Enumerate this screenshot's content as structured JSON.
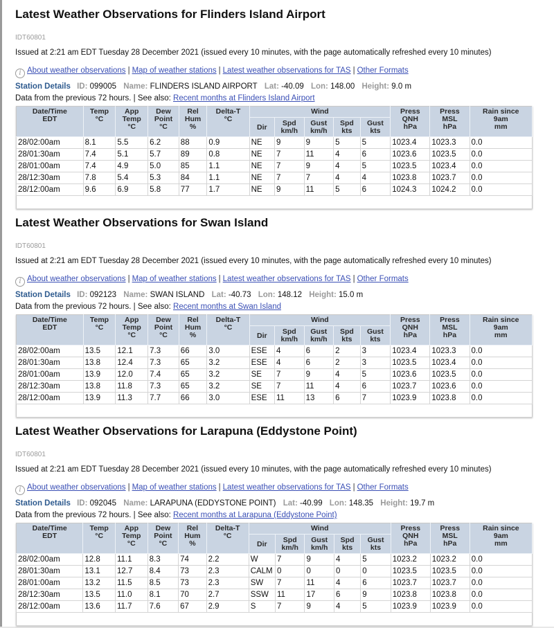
{
  "columns": {
    "date": [
      "Date/Time",
      "EDT"
    ],
    "temp": [
      "Temp",
      "°C"
    ],
    "app_temp": [
      "App",
      "Temp",
      "°C"
    ],
    "dew": [
      "Dew",
      "Point",
      "°C"
    ],
    "hum": [
      "Rel",
      "Hum",
      "%"
    ],
    "delta_t": [
      "Delta-T",
      "°C"
    ],
    "wind": "Wind",
    "dir": "Dir",
    "spd_kmh": [
      "Spd",
      "km/h"
    ],
    "gust_kmh": [
      "Gust",
      "km/h"
    ],
    "spd_kts": [
      "Spd",
      "kts"
    ],
    "gust_kts": [
      "Gust",
      "kts"
    ],
    "press_qnh": [
      "Press",
      "QNH",
      "hPa"
    ],
    "press_msl": [
      "Press",
      "MSL",
      "hPa"
    ],
    "rain": [
      "Rain since",
      "9am",
      "mm"
    ]
  },
  "labels": {
    "station_details": "Station Details",
    "id": "ID:",
    "name": "Name:",
    "lat": "Lat:",
    "lon": "Lon:",
    "height": "Height:",
    "data_from": "Data from the previous 72 hours. | See also:",
    "separator": "|"
  },
  "links": {
    "about": "About weather observations",
    "map": "Map of weather stations",
    "latest_tas": "Latest weather observations for TAS",
    "other_formats": "Other Formats"
  },
  "sections": [
    {
      "title": "Latest Weather Observations for Flinders Island Airport",
      "product_id": "IDT60801",
      "issued": "Issued at 2:21 am EDT Tuesday 28 December 2021 (issued every 10 minutes, with the page automatically refreshed every 10 minutes)",
      "station": {
        "id": "099005",
        "name": "FLINDERS ISLAND AIRPORT",
        "lat": "-40.09",
        "lon": "148.00",
        "height": "9.0 m"
      },
      "recent_link": "Recent months at Flinders Island Airport",
      "rows": [
        [
          "28/02:00am",
          "8.1",
          "5.5",
          "6.2",
          "88",
          "0.9",
          "NE",
          "9",
          "9",
          "5",
          "5",
          "1023.4",
          "1023.3",
          "0.0"
        ],
        [
          "28/01:30am",
          "7.4",
          "5.1",
          "5.7",
          "89",
          "0.8",
          "NE",
          "7",
          "11",
          "4",
          "6",
          "1023.6",
          "1023.5",
          "0.0"
        ],
        [
          "28/01:00am",
          "7.4",
          "4.9",
          "5.0",
          "85",
          "1.1",
          "NE",
          "7",
          "9",
          "4",
          "5",
          "1023.5",
          "1023.4",
          "0.0"
        ],
        [
          "28/12:30am",
          "7.8",
          "5.4",
          "5.3",
          "84",
          "1.1",
          "NE",
          "7",
          "7",
          "4",
          "4",
          "1023.8",
          "1023.7",
          "0.0"
        ],
        [
          "28/12:00am",
          "9.6",
          "6.9",
          "5.8",
          "77",
          "1.7",
          "NE",
          "9",
          "11",
          "5",
          "6",
          "1024.3",
          "1024.2",
          "0.0"
        ]
      ]
    },
    {
      "title": "Latest Weather Observations for Swan Island",
      "product_id": "IDT60801",
      "issued": "Issued at 2:21 am EDT Tuesday 28 December 2021 (issued every 10 minutes, with the page automatically refreshed every 10 minutes)",
      "station": {
        "id": "092123",
        "name": "SWAN ISLAND",
        "lat": "-40.73",
        "lon": "148.12",
        "height": "15.0 m"
      },
      "recent_link": "Recent months at Swan Island",
      "rows": [
        [
          "28/02:00am",
          "13.5",
          "12.1",
          "7.3",
          "66",
          "3.0",
          "ESE",
          "4",
          "6",
          "2",
          "3",
          "1023.4",
          "1023.3",
          "0.0"
        ],
        [
          "28/01:30am",
          "13.8",
          "12.4",
          "7.3",
          "65",
          "3.2",
          "ESE",
          "4",
          "6",
          "2",
          "3",
          "1023.5",
          "1023.4",
          "0.0"
        ],
        [
          "28/01:00am",
          "13.9",
          "12.0",
          "7.4",
          "65",
          "3.2",
          "SE",
          "7",
          "9",
          "4",
          "5",
          "1023.6",
          "1023.5",
          "0.0"
        ],
        [
          "28/12:30am",
          "13.8",
          "11.8",
          "7.3",
          "65",
          "3.2",
          "SE",
          "7",
          "11",
          "4",
          "6",
          "1023.7",
          "1023.6",
          "0.0"
        ],
        [
          "28/12:00am",
          "13.9",
          "11.3",
          "7.7",
          "66",
          "3.0",
          "ESE",
          "11",
          "13",
          "6",
          "7",
          "1023.9",
          "1023.8",
          "0.0"
        ]
      ]
    },
    {
      "title": "Latest Weather Observations for Larapuna (Eddystone Point)",
      "product_id": "IDT60801",
      "issued": "Issued at 2:21 am EDT Tuesday 28 December 2021 (issued every 10 minutes, with the page automatically refreshed every 10 minutes)",
      "station": {
        "id": "092045",
        "name": "LARAPUNA (EDDYSTONE POINT)",
        "lat": "-40.99",
        "lon": "148.35",
        "height": "19.7 m"
      },
      "recent_link": "Recent months at Larapuna (Eddystone Point)",
      "rows": [
        [
          "28/02:00am",
          "12.8",
          "11.1",
          "8.3",
          "74",
          "2.2",
          "W",
          "7",
          "9",
          "4",
          "5",
          "1023.2",
          "1023.2",
          "0.0"
        ],
        [
          "28/01:30am",
          "13.1",
          "12.7",
          "8.4",
          "73",
          "2.3",
          "CALM",
          "0",
          "0",
          "0",
          "0",
          "1023.5",
          "1023.5",
          "0.0"
        ],
        [
          "28/01:00am",
          "13.2",
          "11.5",
          "8.5",
          "73",
          "2.3",
          "SW",
          "7",
          "11",
          "4",
          "6",
          "1023.7",
          "1023.7",
          "0.0"
        ],
        [
          "28/12:30am",
          "13.5",
          "11.0",
          "8.1",
          "70",
          "2.7",
          "SSW",
          "11",
          "17",
          "6",
          "9",
          "1023.8",
          "1023.8",
          "0.0"
        ],
        [
          "28/12:00am",
          "13.6",
          "11.7",
          "7.6",
          "67",
          "2.9",
          "S",
          "7",
          "9",
          "4",
          "5",
          "1023.9",
          "1023.9",
          "0.0"
        ]
      ]
    }
  ]
}
